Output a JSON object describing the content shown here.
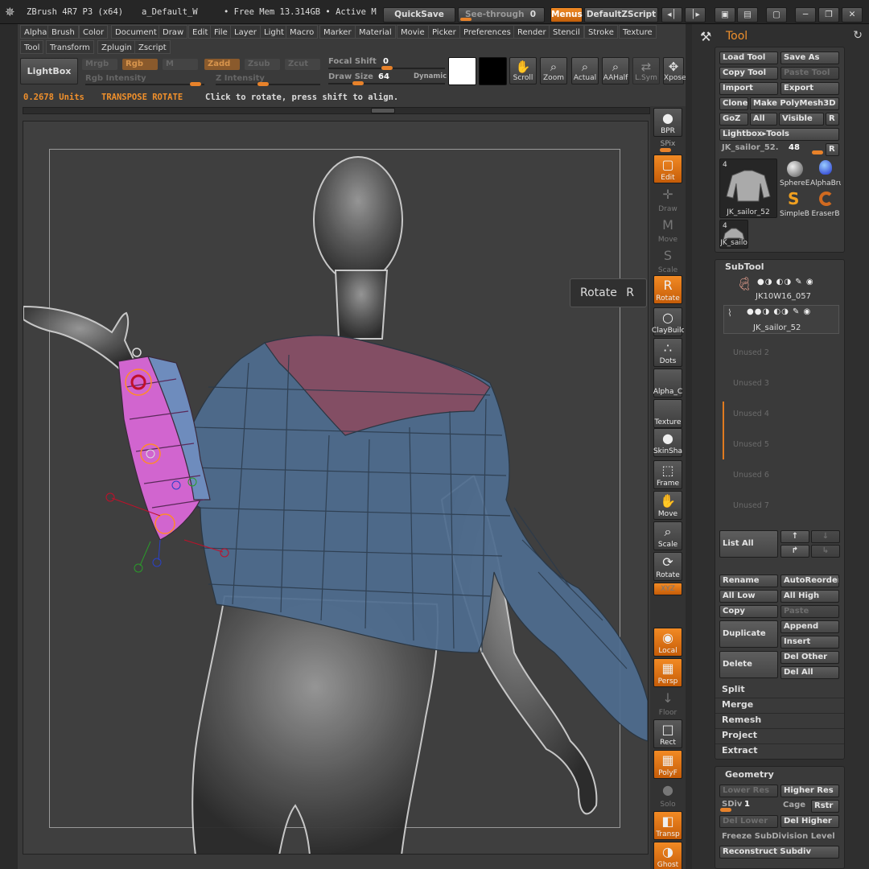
{
  "titlebar": {
    "app_name": "ZBrush 4R7 P3 (x64)",
    "document": "a_Default_W",
    "memory": "• Free Mem 13.314GB • Active M",
    "quicksave": "QuickSave",
    "see_through_label": "See-through",
    "see_through_value": "0",
    "menus": "Menus",
    "default_zscript": "DefaultZScript"
  },
  "menu": [
    "Alpha",
    "Brush",
    "Color",
    "Document",
    "Draw",
    "Edit",
    "File",
    "Layer",
    "Light",
    "Macro",
    "Marker",
    "Material",
    "Movie",
    "Picker",
    "Preferences",
    "Render",
    "Stencil",
    "Stroke",
    "Texture",
    "Tool",
    "Transform",
    "Zplugin",
    "Zscript"
  ],
  "shelf": {
    "lightbox": "LightBox",
    "mrgb": "Mrgb",
    "rgb": "Rgb",
    "m": "M",
    "zadd": "Zadd",
    "zsub": "Zsub",
    "zcut": "Zcut",
    "rgb_intensity": "Rgb Intensity",
    "z_intensity": "Z Intensity",
    "focal_shift_label": "Focal Shift",
    "focal_shift_value": "0",
    "draw_size_label": "Draw Size",
    "draw_size_value": "64",
    "dynamic": "Dynamic",
    "scroll": "Scroll",
    "zoom": "Zoom",
    "actual": "Actual",
    "aahalf": "AAHalf",
    "lsym": "L.Sym",
    "xpose": "Xpose"
  },
  "status": {
    "units": "0.2678 Units",
    "mode": "TRANSPOSE ROTATE",
    "hint": "Click to rotate, press shift to align."
  },
  "tooltip": {
    "label": "Rotate",
    "key": "R"
  },
  "right_shelf": [
    {
      "label": "BPR",
      "icon": "bpr-icon",
      "state": "normal"
    },
    {
      "label": "SPix",
      "icon": "spix-icon",
      "state": "normal"
    },
    {
      "label": "Edit",
      "icon": "edit-icon",
      "state": "active"
    },
    {
      "label": "Draw",
      "icon": "draw-icon",
      "state": "disabled"
    },
    {
      "label": "Move",
      "icon": "move-icon",
      "state": "disabled"
    },
    {
      "label": "Scale",
      "icon": "scale-icon",
      "state": "disabled"
    },
    {
      "label": "Rotate",
      "icon": "rotate-icon",
      "state": "active"
    },
    {
      "label": "ClayBuild",
      "icon": "claybuild-icon",
      "state": "normal"
    },
    {
      "label": "Dots",
      "icon": "dots-icon",
      "state": "normal"
    },
    {
      "label": "Alpha_C",
      "icon": "alpha-icon",
      "state": "normal"
    },
    {
      "label": "Texture",
      "icon": "texture-icon",
      "state": "normal"
    },
    {
      "label": "SkinSha",
      "icon": "material-icon",
      "state": "normal"
    },
    {
      "label": "Frame",
      "icon": "frame-icon",
      "state": "normal"
    },
    {
      "label": "Move",
      "icon": "move-hand-icon",
      "state": "normal"
    },
    {
      "label": "Scale",
      "icon": "scale-zoom-icon",
      "state": "normal"
    },
    {
      "label": "Rotate",
      "icon": "rotate-view-icon",
      "state": "normal"
    },
    {
      "label": "XYZ",
      "icon": "xyz-icon",
      "state": "active"
    },
    {
      "label": "Local",
      "icon": "local-icon",
      "state": "active"
    },
    {
      "label": "Persp",
      "icon": "persp-icon",
      "state": "active"
    },
    {
      "label": "Floor",
      "icon": "floor-icon",
      "state": "disabled"
    },
    {
      "label": "Rect",
      "icon": "rect-icon",
      "state": "normal"
    },
    {
      "label": "PolyF",
      "icon": "polyframe-icon",
      "state": "active"
    },
    {
      "label": "Solo",
      "icon": "solo-icon",
      "state": "disabled"
    },
    {
      "label": "Transp",
      "icon": "transp-icon",
      "state": "active"
    },
    {
      "label": "Ghost",
      "icon": "ghost-icon",
      "state": "active"
    }
  ],
  "right_shelf_extra": {
    "dynamic": "ynamic",
    "polyfill": "PolyF"
  },
  "tool_palette": {
    "title": "Tool",
    "load_tool": "Load Tool",
    "save_as": "Save As",
    "copy_tool": "Copy Tool",
    "paste_tool": "Paste Tool",
    "import": "Import",
    "export": "Export",
    "clone": "Clone",
    "make_polymesh": "Make PolyMesh3D",
    "goz": "GoZ",
    "all": "All",
    "visible": "Visible",
    "r": "R",
    "lightbox_tools": "Lightbox▸Tools",
    "current_tool": "JK_sailor_52.",
    "current_value": "48",
    "thumbs": [
      {
        "caption": "JK_sailor_52",
        "num": "4"
      },
      {
        "caption": "SphereE"
      },
      {
        "caption": "AlphaBru"
      },
      {
        "caption": "SimpleBi"
      },
      {
        "caption": "EraserB"
      },
      {
        "caption": "JK_sailo",
        "num": "4"
      }
    ]
  },
  "subtool": {
    "title": "SubTool",
    "items": [
      "JK10W16_057",
      "JK_sailor_52"
    ],
    "unused": [
      "Unused 2",
      "Unused 3",
      "Unused 4",
      "Unused 5",
      "Unused 6",
      "Unused 7"
    ],
    "list_all": "List All",
    "rename": "Rename",
    "autoreorder": "AutoReorder",
    "all_low": "All Low",
    "all_high": "All High",
    "copy": "Copy",
    "paste": "Paste",
    "duplicate": "Duplicate",
    "append": "Append",
    "insert": "Insert",
    "delete": "Delete",
    "del_other": "Del Other",
    "del_all": "Del All",
    "split": "Split",
    "merge": "Merge",
    "remesh": "Remesh",
    "project": "Project",
    "extract": "Extract"
  },
  "geometry": {
    "title": "Geometry",
    "lower_res": "Lower Res",
    "higher_res": "Higher Res",
    "sdiv_label": "SDiv",
    "sdiv_value": "1",
    "cage": "Cage",
    "rstr": "Rstr",
    "del_lower": "Del Lower",
    "del_higher": "Del Higher",
    "freeze": "Freeze SubDivision Level",
    "reconstruct": "Reconstruct Subdiv"
  }
}
